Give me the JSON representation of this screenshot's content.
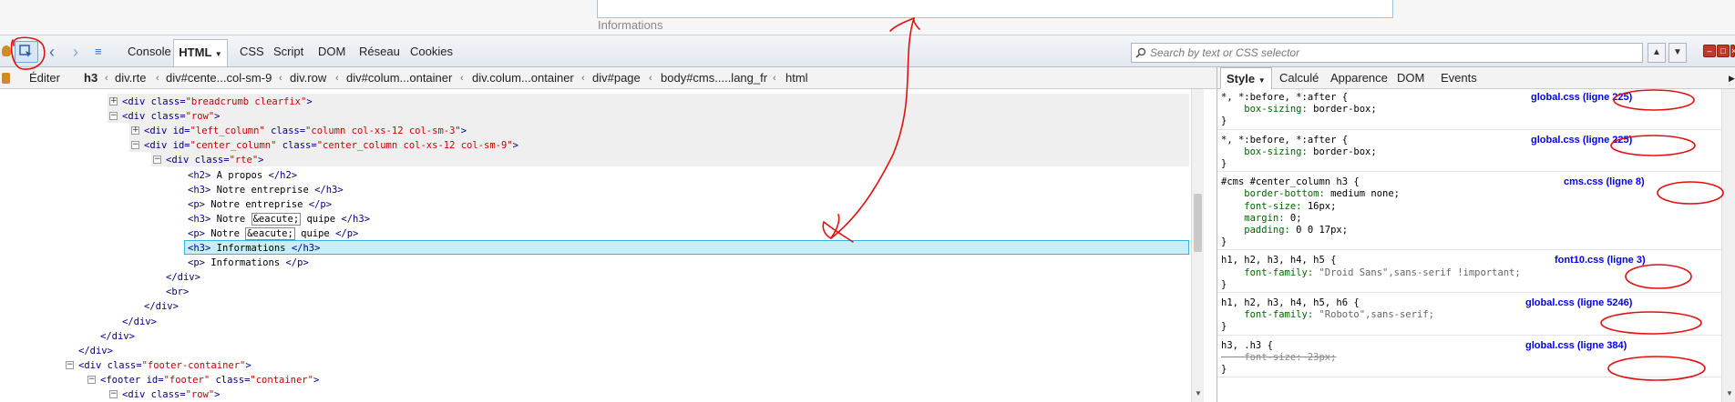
{
  "preview": {
    "info_text": "Informations"
  },
  "toolbar": {
    "tabs": [
      "Console",
      "HTML",
      "CSS",
      "Script",
      "DOM",
      "Réseau",
      "Cookies"
    ],
    "search_placeholder": "Search by text or CSS selector"
  },
  "breadcrumb": {
    "edit_label": "Éditer",
    "items": [
      "h3",
      "div.rte",
      "div#cente...col-sm-9",
      "div.row",
      "div#colum...ontainer",
      "div.colum...ontainer",
      "div#page",
      "body#cms.....lang_fr",
      "html"
    ]
  },
  "side_tabs": [
    "Style",
    "Calculé",
    "Apparence",
    "DOM",
    "Events"
  ],
  "html_tree": {
    "lines": [
      {
        "indent": 0,
        "open": "+",
        "tag": "div",
        "attrs": [
          [
            "class",
            "breadcrumb clearfix"
          ]
        ],
        "close": ">"
      },
      {
        "indent": 0,
        "open": "-",
        "tag": "div",
        "attrs": [
          [
            "class",
            "row"
          ]
        ],
        "close": ">"
      },
      {
        "indent": 1,
        "open": "+",
        "tag": "div",
        "attrs": [
          [
            "id",
            "left_column"
          ],
          [
            "class",
            "column col-xs-12 col-sm-3"
          ]
        ],
        "close": ">"
      },
      {
        "indent": 1,
        "open": "-",
        "tag": "div",
        "attrs": [
          [
            "id",
            "center_column"
          ],
          [
            "class",
            "center_column col-xs-12 col-sm-9"
          ]
        ],
        "close": ">"
      },
      {
        "indent": 2,
        "open": "-",
        "tag": "div",
        "attrs": [
          [
            "class",
            "rte"
          ]
        ],
        "close": ">"
      },
      {
        "indent": 3,
        "text": "<h2> A propos </h2>"
      },
      {
        "indent": 3,
        "text": "<h3> Notre entreprise </h3>"
      },
      {
        "indent": 3,
        "text": "<p> Notre entreprise </p>"
      },
      {
        "indent": 3,
        "text": "<h3> Notre [&eacute;] quipe </h3>"
      },
      {
        "indent": 3,
        "text": "<p> Notre [&eacute;] quipe </p>"
      },
      {
        "indent": 3,
        "text": "<h3> Informations </h3>",
        "selected": true
      },
      {
        "indent": 3,
        "text": "<p> Informations </p>"
      },
      {
        "indent": 2,
        "text": "</div>"
      },
      {
        "indent": 2,
        "text": "<br>"
      },
      {
        "indent": 1,
        "text": "</div>"
      },
      {
        "indent": 0,
        "text": "</div>"
      },
      {
        "indent": -1,
        "text": "</div>"
      },
      {
        "indent": -2,
        "text": "</div>"
      },
      {
        "indent": -2,
        "open": "-",
        "tag": "div",
        "attrs": [
          [
            "class",
            "footer-container"
          ]
        ],
        "close": ">"
      },
      {
        "indent": -1,
        "open": "-",
        "tag": "footer",
        "attrs": [
          [
            "id",
            "footer"
          ],
          [
            "class",
            "container"
          ]
        ],
        "close": ">"
      },
      {
        "indent": 0,
        "open": "-",
        "tag": "div",
        "attrs": [
          [
            "class",
            "row"
          ]
        ],
        "close": ">"
      }
    ]
  },
  "css_rules": [
    {
      "selector": "*, *:before, *:after {",
      "props": [
        [
          "box-sizing",
          "border-box;"
        ]
      ],
      "source": "global.css (ligne 225)"
    },
    {
      "selector": "*, *:before, *:after {",
      "props": [
        [
          "box-sizing",
          "border-box;"
        ]
      ],
      "source": "global.css (ligne 225)"
    },
    {
      "selector": "#cms #center_column h3 {",
      "props": [
        [
          "border-bottom",
          "medium none;"
        ],
        [
          "font-size",
          "16px;"
        ],
        [
          "margin",
          "0;"
        ],
        [
          "padding",
          "0 0 17px;"
        ]
      ],
      "source": "cms.css (ligne 8)"
    },
    {
      "selector": "h1, h2, h3, h4, h5 {",
      "props": [
        [
          "font-family",
          "\"Droid Sans\",sans-serif !important;"
        ]
      ],
      "source": "font10.css (ligne 3)"
    },
    {
      "selector": "h1, h2, h3, h4, h5, h6 {",
      "props": [
        [
          "font-family",
          "\"Roboto\",sans-serif;"
        ]
      ],
      "source": "global.css (ligne 5246)"
    },
    {
      "selector": "h3, .h3 {",
      "props": [
        [
          "font-size",
          "23px;",
          "strike"
        ]
      ],
      "source": "global.css (ligne 384)"
    }
  ],
  "colors": {
    "annotation": "#e01010",
    "selection": "#c8eefa",
    "link": "#0000ee"
  }
}
